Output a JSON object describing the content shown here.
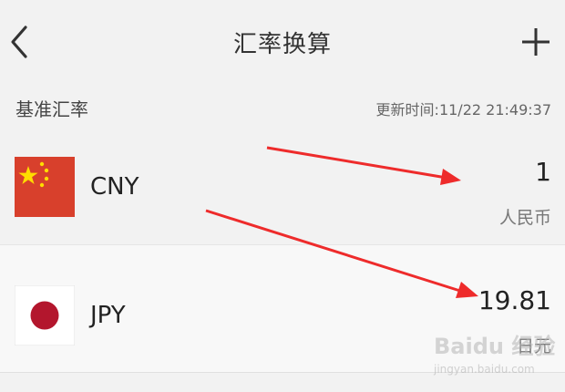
{
  "header": {
    "title": "汇率换算",
    "back_icon": "chevron-left-icon",
    "add_icon": "plus-icon"
  },
  "subheader": {
    "base_label": "基准汇率",
    "update_time": "更新时间:11/22 21:49:37"
  },
  "currencies": [
    {
      "code": "CNY",
      "amount": "1",
      "name": "人民币",
      "flag_icon": "china-flag-icon",
      "flag_color": "#d8402c"
    },
    {
      "code": "JPY",
      "amount": "19.81",
      "name": "日元",
      "flag_icon": "japan-flag-icon",
      "flag_color": "#b3162d"
    }
  ],
  "annotation_color": "#ee2b2b",
  "watermark": {
    "text": "Baidu 经验",
    "sub": "jingyan.baidu.com"
  }
}
